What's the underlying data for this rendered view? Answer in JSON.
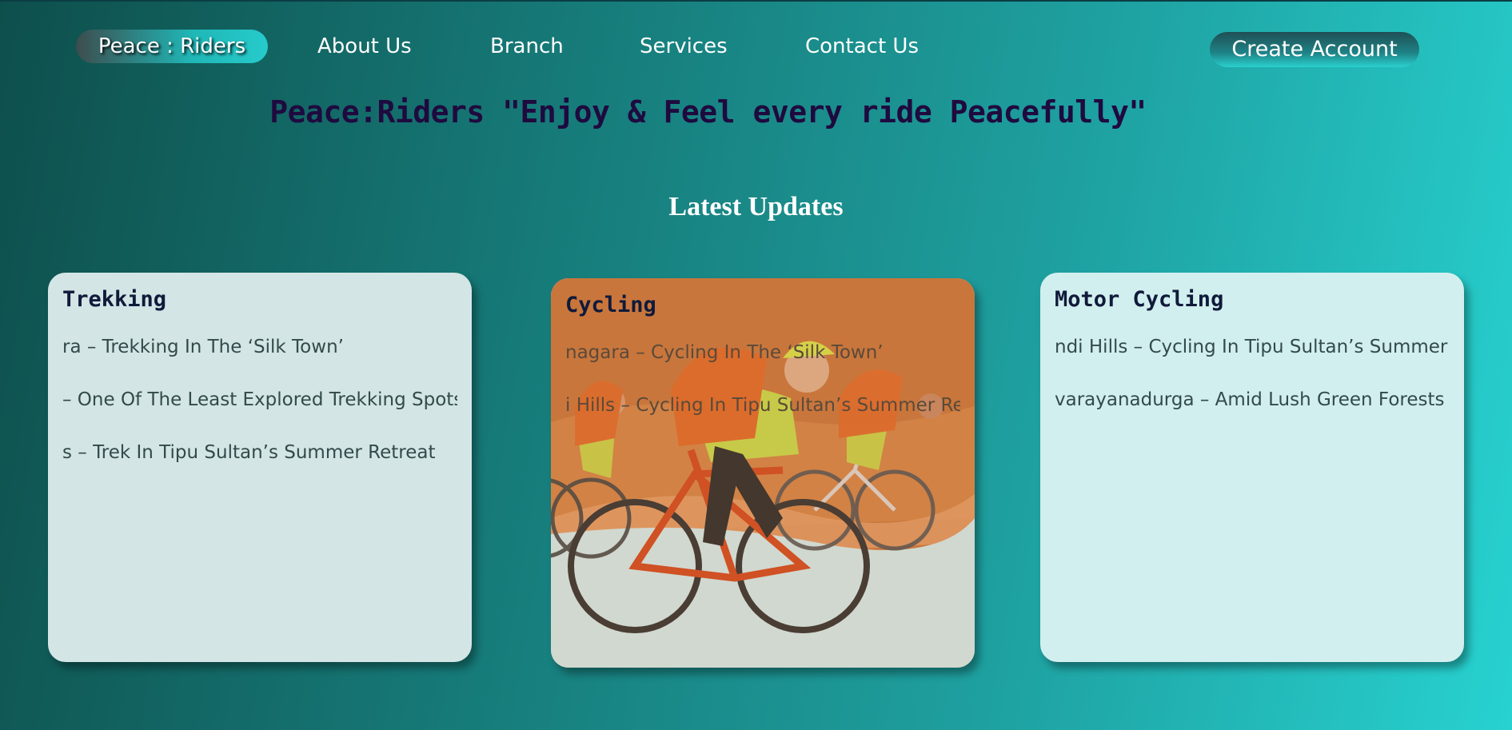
{
  "nav": {
    "brand": "Peace : Riders",
    "links": [
      "About Us",
      "Branch",
      "Services",
      "Contact Us"
    ],
    "create_account": "Create Account"
  },
  "tagline": "Peace:Riders \"Enjoy & Feel every ride Peacefully\"",
  "section_title": "Latest Updates",
  "cards": [
    {
      "title": "Trekking",
      "lines": [
        "ra – Trekking In The ‘Silk Town’",
        " – One Of The Least Explored Trekking Spots",
        "s – Trek In Tipu Sultan’s Summer Retreat"
      ]
    },
    {
      "title": "Cycling",
      "lines": [
        "nagara – Cycling In The ‘Silk Town’",
        "i Hills – Cycling In Tipu Sultan’s Summer Retreat"
      ]
    },
    {
      "title": "Motor Cycling",
      "lines": [
        "ndi Hills – Cycling In Tipu Sultan’s Summer Retreat",
        "varayanadurga – Amid Lush Green Forests And"
      ]
    }
  ],
  "colors": {
    "background_left": "#0e4f4c",
    "background_right": "#27d2d0",
    "tagline": "#1f0a3f",
    "card_orange": "#c9763c"
  }
}
